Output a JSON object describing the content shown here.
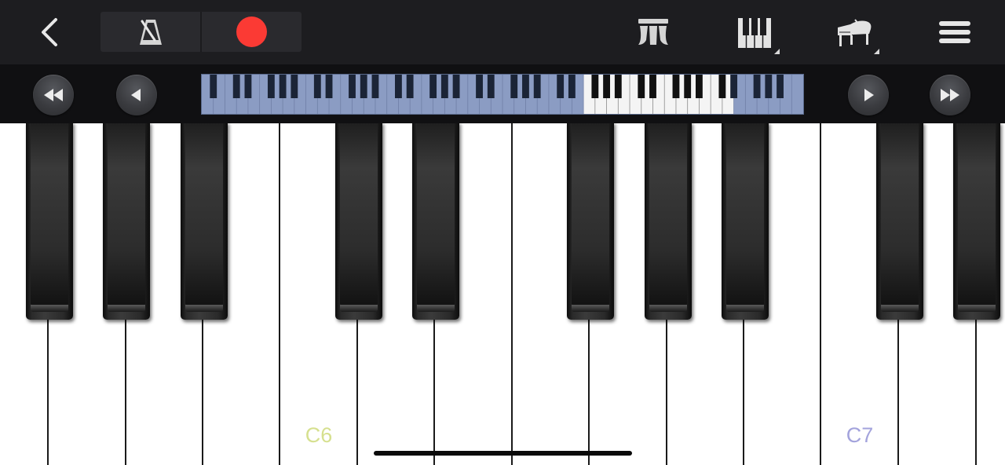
{
  "toolbar": {
    "back_icon": "chevron-left-icon",
    "metronome_icon": "metronome-icon",
    "record_icon": "record-icon",
    "sustain_icon": "sustain-pedal-icon",
    "keys_icon": "keyboard-layout-icon",
    "instrument_icon": "grand-piano-icon",
    "menu_icon": "hamburger-menu-icon",
    "record_color": "#fb3a34"
  },
  "navigation": {
    "buttons": [
      {
        "name": "scroll-far-left-button",
        "icon": "fast-rewind-icon"
      },
      {
        "name": "scroll-left-button",
        "icon": "play-left-icon"
      },
      {
        "name": "scroll-right-button",
        "icon": "play-right-icon"
      },
      {
        "name": "scroll-far-right-button",
        "icon": "fast-forward-icon"
      }
    ],
    "mini_keyboard": {
      "total_white_keys": 52,
      "visible_window_start_key": 33,
      "visible_window_key_count": 13,
      "range_color": "#8b9cc3"
    }
  },
  "keyboard": {
    "labels": [
      {
        "key": "C6",
        "text": "C6",
        "color": "#d6e08f"
      },
      {
        "key": "C7",
        "text": "C7",
        "color": "#a3a3dc"
      }
    ]
  }
}
